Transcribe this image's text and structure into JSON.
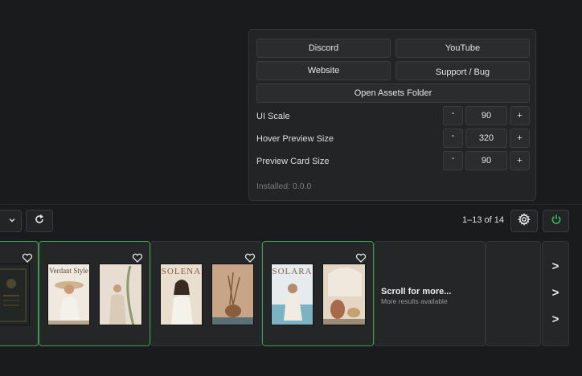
{
  "settings": {
    "discord_label": "Discord",
    "youtube_label": "YouTube",
    "website_label": "Website",
    "support_label": "Support / Bug",
    "assets_label": "Open Assets Folder",
    "rows": [
      {
        "label": "UI Scale",
        "minus": "-",
        "value": "90",
        "plus": "+"
      },
      {
        "label": "Hover Preview Size",
        "minus": "-",
        "value": "320",
        "plus": "+"
      },
      {
        "label": "Preview Card Size",
        "minus": "-",
        "value": "90",
        "plus": "+"
      }
    ],
    "installed": "Installed: 0.0.0"
  },
  "toolbar": {
    "pager": "1–13 of 14",
    "dropdown_icon": "chevron-down-icon",
    "refresh_icon": "refresh-icon",
    "settings_icon": "gear-icon",
    "power_icon": "power-icon",
    "power_color": "#3fae56"
  },
  "cards": {
    "magazine_titles": [
      "Verdant Style",
      "SOLENA",
      "SOLARA"
    ],
    "scroll_title": "Scroll for more...",
    "scroll_subtitle": "More results available",
    "chevrons": [
      ">",
      ">",
      ">"
    ],
    "accent": "#3f9d52"
  }
}
